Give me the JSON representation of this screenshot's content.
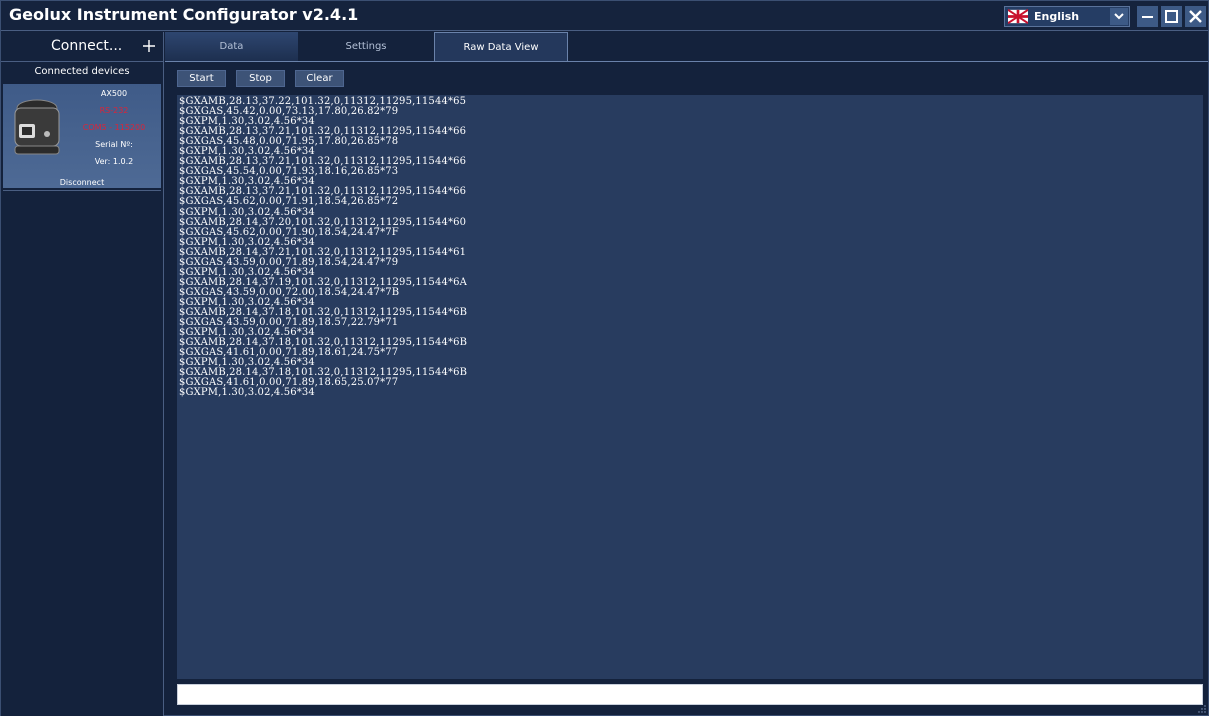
{
  "window": {
    "title": "Geolux Instrument Configurator v2.4.1",
    "language": "English",
    "flag_icon": "uk-flag-icon"
  },
  "sidebar": {
    "connect_label": "Connect...",
    "devices_header": "Connected devices",
    "device": {
      "model": "AX500",
      "protocol": "RS-232",
      "port": "COM5 - 115200",
      "serial_label": "Serial Nº:",
      "version": "Ver: 1.0.2",
      "disconnect_label": "Disconnect"
    }
  },
  "tabs": [
    {
      "label": "Data",
      "active": false
    },
    {
      "label": "Settings",
      "active": false
    },
    {
      "label": "Raw Data View",
      "active": true
    }
  ],
  "toolbar": {
    "start_label": "Start",
    "stop_label": "Stop",
    "clear_label": "Clear"
  },
  "log_lines": [
    "$GXAMB,28.13,37.22,101.32,0,11312,11295,11544*65",
    "$GXGAS,45.42,0.00,73.13,17.80,26.82*79",
    "$GXPM,1.30,3.02,4.56*34",
    "$GXAMB,28.13,37.21,101.32,0,11312,11295,11544*66",
    "$GXGAS,45.48,0.00,71.95,17.80,26.85*78",
    "$GXPM,1.30,3.02,4.56*34",
    "$GXAMB,28.13,37.21,101.32,0,11312,11295,11544*66",
    "$GXGAS,45.54,0.00,71.93,18.16,26.85*73",
    "$GXPM,1.30,3.02,4.56*34",
    "$GXAMB,28.13,37.21,101.32,0,11312,11295,11544*66",
    "$GXGAS,45.62,0.00,71.91,18.54,26.85*72",
    "$GXPM,1.30,3.02,4.56*34",
    "$GXAMB,28.14,37.20,101.32,0,11312,11295,11544*60",
    "$GXGAS,45.62,0.00,71.90,18.54,24.47*7F",
    "$GXPM,1.30,3.02,4.56*34",
    "$GXAMB,28.14,37.21,101.32,0,11312,11295,11544*61",
    "$GXGAS,43.59,0.00,71.89,18.54,24.47*79",
    "$GXPM,1.30,3.02,4.56*34",
    "$GXAMB,28.14,37.19,101.32,0,11312,11295,11544*6A",
    "$GXGAS,43.59,0.00,72.00,18.54,24.47*7B",
    "$GXPM,1.30,3.02,4.56*34",
    "$GXAMB,28.14,37.18,101.32,0,11312,11295,11544*6B",
    "$GXGAS,43.59,0.00,71.89,18.57,22.79*71",
    "$GXPM,1.30,3.02,4.56*34",
    "$GXAMB,28.14,37.18,101.32,0,11312,11295,11544*6B",
    "$GXGAS,41.61,0.00,71.89,18.61,24.75*77",
    "$GXPM,1.30,3.02,4.56*34",
    "$GXAMB,28.14,37.18,101.32,0,11312,11295,11544*6B",
    "$GXGAS,41.61,0.00,71.89,18.65,25.07*77",
    "$GXPM,1.30,3.02,4.56*34"
  ],
  "command_input": {
    "value": "",
    "placeholder": ""
  },
  "colors": {
    "background": "#14223c",
    "log_background": "#283c5f",
    "accent": "#3d5a86",
    "device_status": "#d9253a"
  }
}
